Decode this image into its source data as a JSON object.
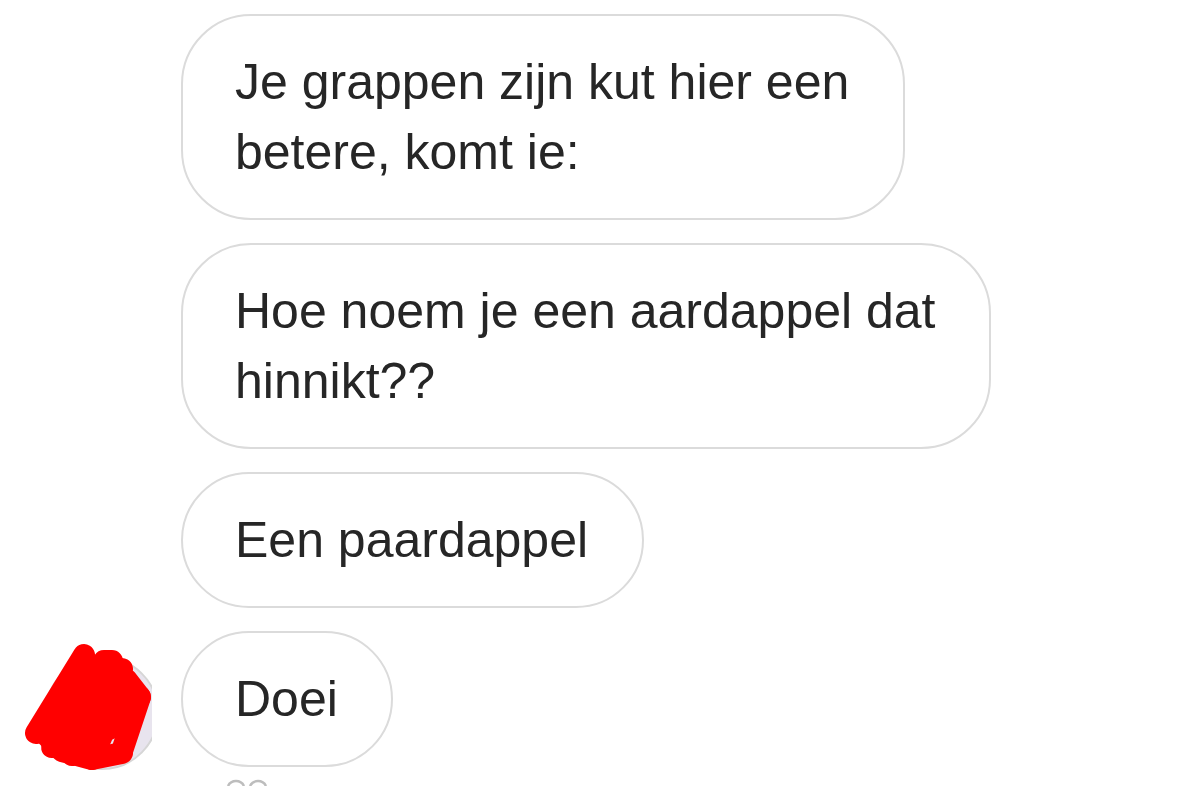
{
  "messages": [
    {
      "text": "Je grappen zijn kut hier een betere, komt ie:",
      "avatar": false
    },
    {
      "text": "Hoe noem je een aardappel dat hinnikt??",
      "avatar": false
    },
    {
      "text": "Een paardappel",
      "avatar": false
    },
    {
      "text": "Doei",
      "avatar": true
    }
  ]
}
